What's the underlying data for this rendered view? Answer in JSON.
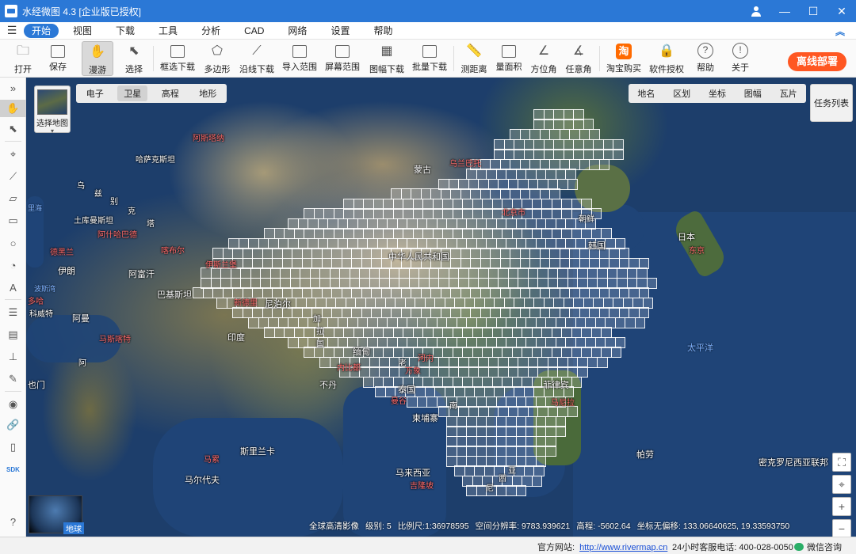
{
  "window": {
    "title": "水经微图 4.3 [企业版已授权]",
    "controls": [
      "user-icon",
      "minimize",
      "maximize",
      "close"
    ]
  },
  "menu": {
    "items": [
      "开始",
      "视图",
      "下载",
      "工具",
      "分析",
      "CAD",
      "网络",
      "设置",
      "帮助"
    ],
    "active": "开始"
  },
  "toolbar": {
    "open": "打开",
    "save": "保存",
    "pan": "漫游",
    "select": "选择",
    "box_download": "框选下载",
    "polygon": "多边形",
    "line_download": "沿线下载",
    "import_range": "导入范围",
    "screen_range": "屏幕范围",
    "sheet_download": "图幅下载",
    "batch_download": "批量下载",
    "measure_distance": "测距离",
    "measure_area": "量面积",
    "azimuth": "方位角",
    "any_angle": "任意角",
    "taobao": "淘宝购买",
    "taobao_glyph": "淘",
    "license": "软件授权",
    "help": "帮助",
    "about": "关于",
    "offline_deploy": "离线部署"
  },
  "map_controls": {
    "select_map": "选择地图",
    "map_types": [
      "电子",
      "卫星",
      "高程",
      "地形"
    ],
    "active_map_type": "卫星",
    "layers": [
      "地名",
      "区划",
      "坐标",
      "图幅",
      "瓦片"
    ],
    "task_list": "任务列表",
    "globe_label": "地球"
  },
  "places": {
    "kazakhstan": "哈萨克斯坦",
    "astana": "阿斯塔纳",
    "mongolia": "蒙古",
    "ulaanbaatar": "乌兰巴托",
    "uzbek1": "乌",
    "uzbek2": "兹",
    "uzbek3": "别",
    "kyrgyz": "克",
    "tajik": "塔",
    "turkmenistan": "土库曼斯坦",
    "ashgabat": "阿什哈巴德",
    "tehran": "德黑兰",
    "iran": "伊朗",
    "kabul": "喀布尔",
    "afghanistan": "阿富汗",
    "pakistan": "巴基斯坦",
    "islamabad": "伊斯兰堡",
    "newdelhi": "新德里",
    "nepal": "尼泊尔",
    "india": "印度",
    "bhutan": "不丹",
    "bangladesh1": "加",
    "bangladesh2": "拉",
    "bangladesh3": "国",
    "myanmar": "缅甸",
    "naypyidaw": "内比都",
    "laos": "老",
    "vientiane": "万象",
    "hanoi": "河内",
    "thailand": "泰国",
    "bangkok": "曼谷",
    "cambodia": "柬埔寨",
    "vietnam": "南",
    "philippines": "菲律宾",
    "manila": "马尼拉",
    "malaysia": "马来西亚",
    "kl": "吉隆坡",
    "indonesia1": "西",
    "indonesia2": "亚",
    "indonesia3": "尼",
    "srilanka": "斯里兰卡",
    "maldives": "马尔代夫",
    "male": "马累",
    "oman": "阿曼",
    "muscat": "马斯喀特",
    "yemen": "也门",
    "sanaa": "阿",
    "doha": "多哈",
    "beijing": "北京市",
    "china": "中华人民共和国",
    "korea": "韩国",
    "northkorea": "朝鲜",
    "japan": "日本",
    "tokyo": "东京",
    "pacific": "太平洋",
    "palau": "帕劳",
    "micronesia": "密克罗尼西亚联邦",
    "caspian": "里海",
    "kuwait": "科威特",
    "persian_gulf": "波斯湾"
  },
  "status": {
    "source": "全球高清影像",
    "level_label": "级别:",
    "level": "5",
    "scale_label": "比例尺:",
    "scale": "1:36978595",
    "resolution_label": "空间分辨率:",
    "resolution": "9783.939621",
    "elevation_label": "高程:",
    "elevation": "-5602.64",
    "coord_label": "坐标无偏移:",
    "coords": "133.06640625, 19.33593750"
  },
  "footer": {
    "website_label": "官方网站:",
    "website": "http://www.rivermap.cn",
    "phone": "24小时客服电话: 400-028-0050",
    "wechat": "微信咨询"
  },
  "colors": {
    "accent": "#2b78d6",
    "offline_button": "#ff5722",
    "grid_line": "#ffffff",
    "capital_label": "#ff6b6b"
  }
}
